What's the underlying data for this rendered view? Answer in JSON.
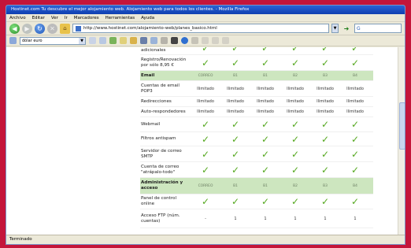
{
  "window": {
    "title": "Hostinet.com Tu descubre el mejor alojamiento web. Alojamiento web para todos los clientes. - Mozilla Firefox"
  },
  "menu": [
    "Archivo",
    "Editar",
    "Ver",
    "Ir",
    "Marcadores",
    "Herramientas",
    "Ayuda"
  ],
  "nav": {
    "url": "http://www.hostinet.com/alojamiento-web/planes_basico.html",
    "search_text": "G"
  },
  "toolbar2": {
    "selected": "dólar euro"
  },
  "table": {
    "rows": [
      {
        "type": "row",
        "label": "Parking de dominios adicionales",
        "cells": [
          "✓",
          "✓",
          "✓",
          "✓",
          "✓",
          "✓"
        ]
      },
      {
        "type": "row",
        "label": "Registro/Renovación por sólo 8,95 €",
        "cells": [
          "✓",
          "✓",
          "✓",
          "✓",
          "✓",
          "✓"
        ]
      },
      {
        "type": "section",
        "label": "Email",
        "cells": [
          "CORREO",
          "B1",
          "B1",
          "B2",
          "B3",
          "B4"
        ]
      },
      {
        "type": "row",
        "label": "Cuentas de email POP3",
        "cells": [
          "Ilimitado",
          "Ilimitado",
          "Ilimitado",
          "Ilimitado",
          "Ilimitado",
          "Ilimitado"
        ]
      },
      {
        "type": "row",
        "label": "Redirecciones",
        "cells": [
          "Ilimitado",
          "Ilimitado",
          "Ilimitado",
          "Ilimitado",
          "Ilimitado",
          "Ilimitado"
        ]
      },
      {
        "type": "row",
        "label": "Auto-respondedores",
        "cells": [
          "Ilimitado",
          "Ilimitado",
          "Ilimitado",
          "Ilimitado",
          "Ilimitado",
          "Ilimitado"
        ]
      },
      {
        "type": "row",
        "label": "Webmail",
        "cells": [
          "✓",
          "✓",
          "✓",
          "✓",
          "✓",
          "✓"
        ]
      },
      {
        "type": "row",
        "label": "Filtros antispam",
        "cells": [
          "✓",
          "✓",
          "✓",
          "✓",
          "✓",
          "✓"
        ]
      },
      {
        "type": "row",
        "label": "Servidor de correo SMTP",
        "cells": [
          "✓",
          "✓",
          "✓",
          "✓",
          "✓",
          "✓"
        ]
      },
      {
        "type": "row",
        "label": "Cuenta de correo \"atrápalo-todo\"",
        "cells": [
          "✓",
          "✓",
          "✓",
          "✓",
          "✓",
          "✓"
        ]
      },
      {
        "type": "section",
        "label": "Administración y acceso",
        "cells": [
          "CORREO",
          "B1",
          "B1",
          "B2",
          "B3",
          "B4"
        ]
      },
      {
        "type": "row",
        "label": "Panel de control online",
        "cells": [
          "✓",
          "✓",
          "✓",
          "✓",
          "✓",
          "✓"
        ]
      },
      {
        "type": "row",
        "label": "Acceso FTP (núm. cuentas)",
        "cells": [
          "-",
          "1",
          "1",
          "1",
          "1",
          "1"
        ]
      }
    ]
  },
  "status": {
    "text": "Terminado"
  }
}
